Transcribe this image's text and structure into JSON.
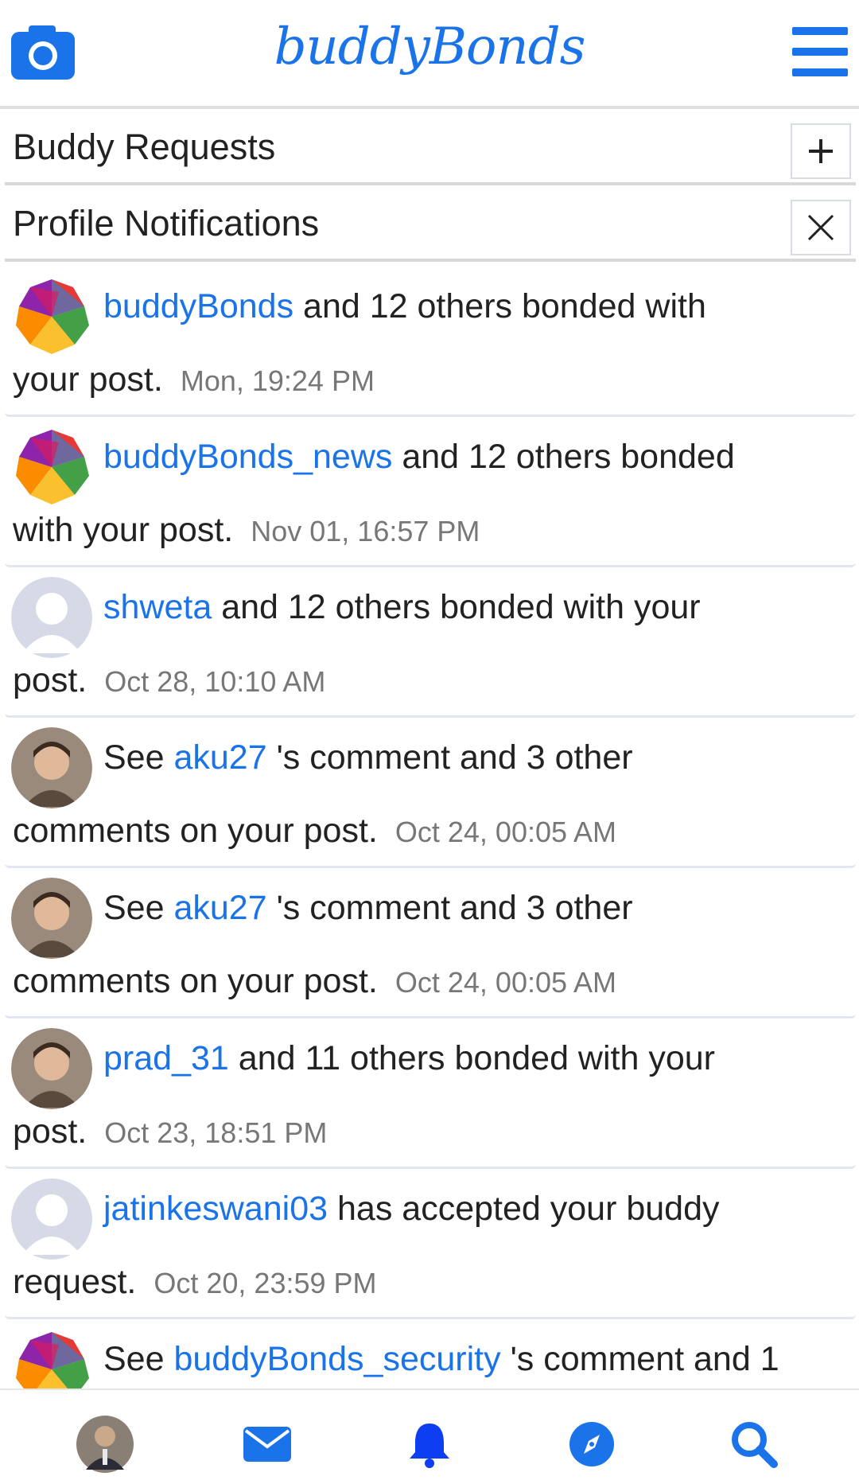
{
  "header": {
    "brand": "buddyBonds",
    "camera_icon": "camera-icon",
    "menu_icon": "hamburger-menu-icon"
  },
  "sections": {
    "buddy_requests": {
      "title": "Buddy Requests",
      "icon": "plus-icon"
    },
    "profile_notifications": {
      "title": "Profile Notifications",
      "icon": "close-icon"
    }
  },
  "notifications": [
    {
      "avatar": "brand-logo",
      "prefix": "",
      "user": "buddyBonds",
      "line1_rest": " and 12 others bonded with",
      "line2": "your post.",
      "time": "Mon, 19:24 PM"
    },
    {
      "avatar": "brand-logo",
      "prefix": "",
      "user": "buddyBonds_news",
      "line1_rest": " and 12 others bonded",
      "line2": "with your post.",
      "time": "Nov 01, 16:57 PM"
    },
    {
      "avatar": "default-avatar",
      "prefix": "",
      "user": "shweta",
      "line1_rest": " and 12 others bonded with your",
      "line2": "post.",
      "time": "Oct 28, 10:10 AM"
    },
    {
      "avatar": "photo-avatar",
      "prefix": "See ",
      "user": "aku27",
      "line1_rest": " 's comment and 3 other",
      "line2": "comments on your post.",
      "time": "Oct 24, 00:05 AM"
    },
    {
      "avatar": "photo-avatar",
      "prefix": "See ",
      "user": "aku27",
      "line1_rest": " 's comment and 3 other",
      "line2": "comments on your post.",
      "time": "Oct 24, 00:05 AM"
    },
    {
      "avatar": "photo-avatar",
      "prefix": "",
      "user": "prad_31",
      "line1_rest": " and 11 others bonded with your",
      "line2": "post.",
      "time": "Oct 23, 18:51 PM"
    },
    {
      "avatar": "default-avatar",
      "prefix": "",
      "user": "jatinkeswani03",
      "line1_rest": " has accepted your buddy",
      "line2": "request.",
      "time": "Oct 20, 23:59 PM"
    },
    {
      "avatar": "brand-logo",
      "prefix": "See ",
      "user": "buddyBonds_security",
      "line1_rest": " 's comment and 1",
      "line2": "",
      "time": ""
    }
  ],
  "bottom_nav": [
    {
      "name": "profile-avatar",
      "icon": "avatar"
    },
    {
      "name": "messages",
      "icon": "envelope-icon"
    },
    {
      "name": "notifications",
      "icon": "bell-icon"
    },
    {
      "name": "explore",
      "icon": "compass-icon"
    },
    {
      "name": "search",
      "icon": "search-icon"
    }
  ],
  "colors": {
    "accent": "#1a73e8",
    "timestamp": "#777777"
  }
}
